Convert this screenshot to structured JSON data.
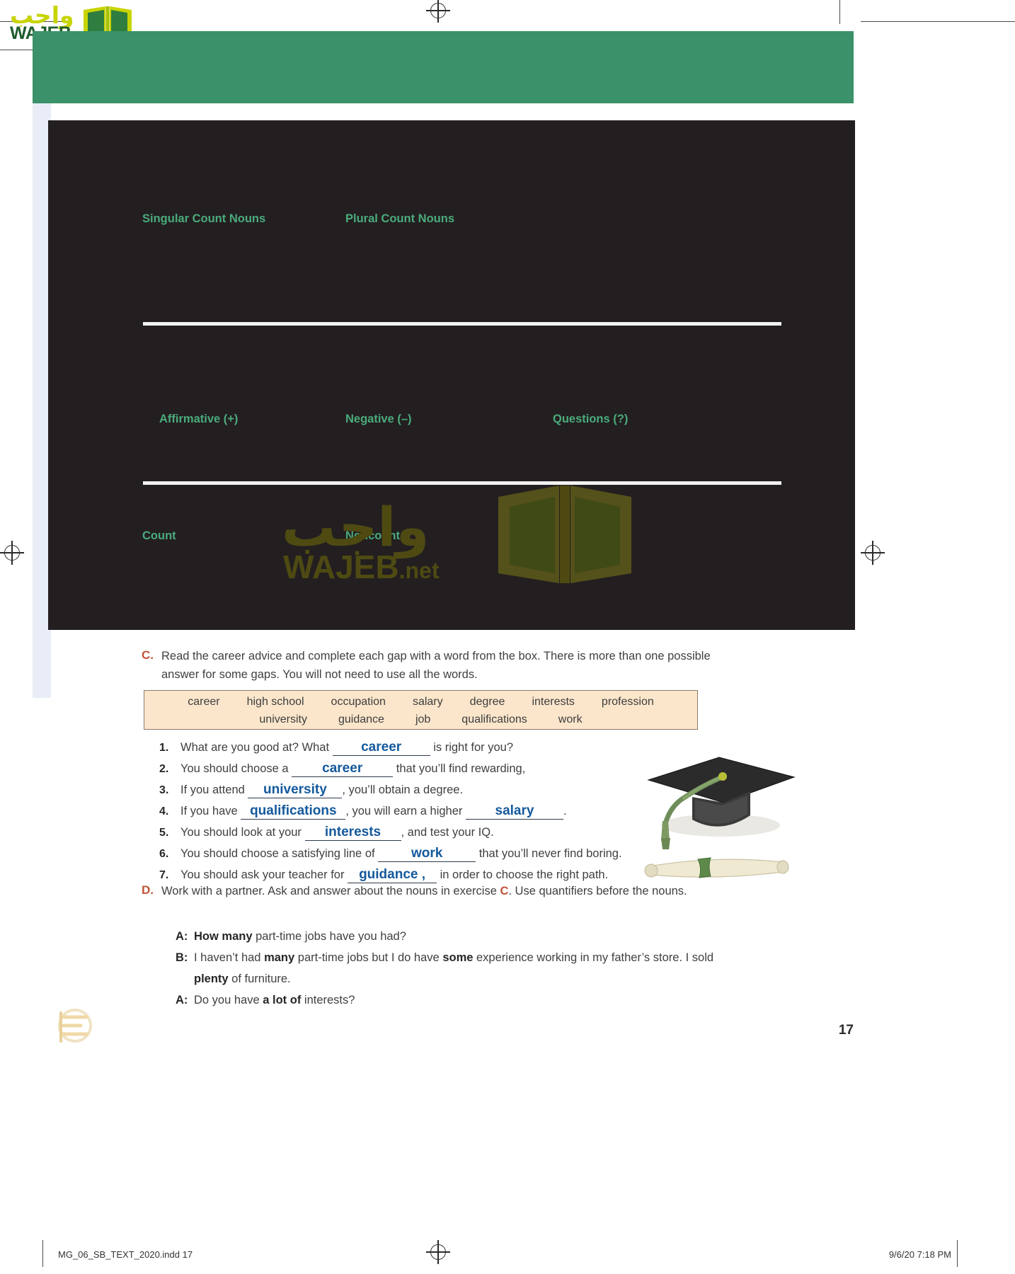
{
  "branding": {
    "arabic_logo": "واجب",
    "latin_logo": "WAJEB",
    "latin_suffix": ".net",
    "book_icon": "open-book-icon"
  },
  "grammar_panel": {
    "row1": [
      {
        "label": "Singular Count Nouns"
      },
      {
        "label": "Plural Count Nouns"
      }
    ],
    "row2": [
      {
        "label": "Affirmative (+)"
      },
      {
        "label": "Negative (–)"
      },
      {
        "label": "Questions (?)"
      }
    ],
    "row3": [
      {
        "label": "Count"
      },
      {
        "label": "Noncount"
      }
    ]
  },
  "exercise_c": {
    "letter": "C.",
    "instruction_line1": "Read the career advice and complete each gap with a word from the box. There is more than one possible",
    "instruction_line2": "answer for some gaps. You will not need to use all the words.",
    "word_box": {
      "row1": [
        "career",
        "high school",
        "occupation",
        "salary",
        "degree",
        "interests",
        "profession"
      ],
      "row2": [
        "university",
        "guidance",
        "job",
        "qualifications",
        "work"
      ]
    },
    "items": [
      {
        "num": "1.",
        "before": "What are you good at? What",
        "answer": "career",
        "after": "is right for you?",
        "blank_width": 130
      },
      {
        "num": "2.",
        "before": "You should choose a",
        "answer": "career",
        "after": "that you’ll find rewarding,",
        "blank_width": 135
      },
      {
        "num": "3.",
        "before": "If you attend",
        "answer": "university",
        "after": ", you’ll obtain a degree.",
        "blank_width": 125
      },
      {
        "num": "4.",
        "before": "If you have",
        "answer": "qualifications",
        "after": ", you will earn a higher",
        "answer2": "salary",
        "after2": ".",
        "blank_width": 140,
        "blank_width2": 130
      },
      {
        "num": "5.",
        "before": "You should look at your",
        "answer": "interests",
        "after": ", and test your IQ.",
        "blank_width": 128
      },
      {
        "num": "6.",
        "before": "You should choose a satisfying line of",
        "answer": "work",
        "after": "that you’ll never find boring.",
        "blank_width": 130
      },
      {
        "num": "7.",
        "before": "You should ask your teacher for",
        "answer": "guidance ,",
        "after": "in order to choose the right path.",
        "blank_width": 118
      }
    ]
  },
  "exercise_d": {
    "letter": "D.",
    "instruction_pre": "Work with a partner. Ask and answer about the nouns in exercise ",
    "instruction_ref": "C",
    "instruction_post": ". Use quantifiers before the nouns.",
    "dialogue": [
      {
        "speaker": "A:",
        "parts": [
          {
            "text": "How many",
            "bold": true
          },
          {
            "text": " part-time jobs have you had?",
            "bold": false
          }
        ]
      },
      {
        "speaker": "B:",
        "parts": [
          {
            "text": "I haven’t had ",
            "bold": false
          },
          {
            "text": "many",
            "bold": true
          },
          {
            "text": " part-time jobs but I do have ",
            "bold": false
          },
          {
            "text": "some",
            "bold": true
          },
          {
            "text": " experience working in my father’s store. I sold",
            "bold": false
          }
        ]
      },
      {
        "speaker": "",
        "parts": [
          {
            "text": "plenty",
            "bold": true
          },
          {
            "text": " of furniture.",
            "bold": false
          }
        ]
      },
      {
        "speaker": "A:",
        "parts": [
          {
            "text": "Do you have ",
            "bold": false
          },
          {
            "text": "a lot of",
            "bold": true
          },
          {
            "text": " interests?",
            "bold": false
          }
        ]
      }
    ]
  },
  "page_number": "17",
  "footer": {
    "file_label": "MG_06_SB_TEXT_2020.indd   17",
    "timestamp": "9/6/20   7:18 PM"
  },
  "colors": {
    "green_band": "#3b9169",
    "dark_panel": "#231f20",
    "heading_green": "#4aab7c",
    "answer_blue": "#14599c",
    "exercise_letter": "#c0543a",
    "word_box_bg": "#fbe6cb"
  }
}
